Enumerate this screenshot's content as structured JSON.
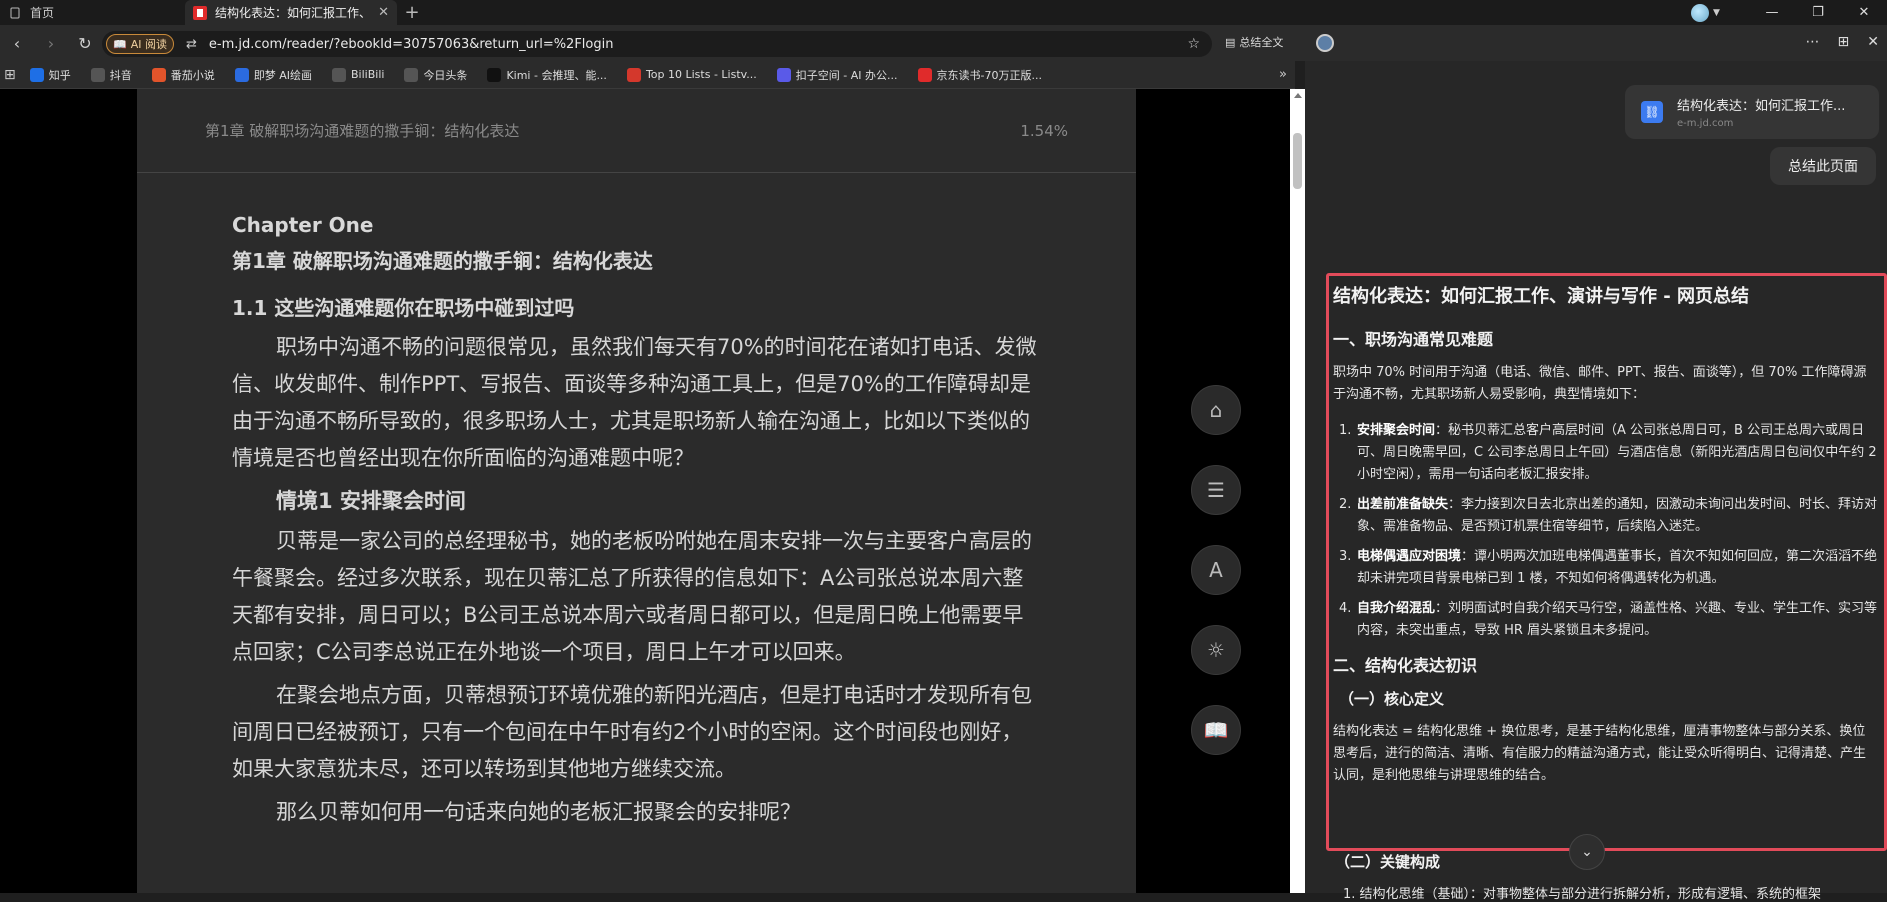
{
  "tabs": {
    "home": "首页",
    "active": "结构化表达：如何汇报工作、演讲与写作"
  },
  "addressbar": {
    "ai_chip": "AI 阅读",
    "url": "e-m.jd.com/reader/?ebookId=30757063&return_url=%2Flogin",
    "summarize_all": "总结全文"
  },
  "bookmarks": [
    {
      "label": "知乎",
      "icon": "zhihu-icon",
      "color": "#1e6fe6"
    },
    {
      "label": "抖音",
      "icon": "globe-icon",
      "color": "#555555"
    },
    {
      "label": "番茄小说",
      "icon": "tomato-icon",
      "color": "#e2542b"
    },
    {
      "label": "即梦 AI绘画",
      "icon": "jimeng-icon",
      "color": "#2b6be0"
    },
    {
      "label": "BiliBili",
      "icon": "globe-icon",
      "color": "#555555"
    },
    {
      "label": "今日头条",
      "icon": "globe-icon",
      "color": "#555555"
    },
    {
      "label": "Kimi - 会推理、能...",
      "icon": "kimi-icon",
      "color": "#111111"
    },
    {
      "label": "Top 10 Lists - Listv...",
      "icon": "listverse-icon",
      "color": "#d4382c"
    },
    {
      "label": "扣子空间 - AI 办公...",
      "icon": "coze-icon",
      "color": "#5a5ae8"
    },
    {
      "label": "京东读书-70万正版...",
      "icon": "jd-icon",
      "color": "#e02b2b"
    }
  ],
  "reader": {
    "header_title": "第1章 破解职场沟通难题的撒手锏：结构化表达",
    "progress": "1.54%",
    "chapter_en": "Chapter One",
    "chapter_cn": "第1章 破解职场沟通难题的撒手锏：结构化表达",
    "section": "1.1 这些沟通难题你在职场中碰到过吗",
    "para1": "职场中沟通不畅的问题很常见，虽然我们每天有70%的时间花在诸如打电话、发微信、收发邮件、制作PPT、写报告、面谈等多种沟通工具上，但是70%的工作障碍却是由于沟通不畅所导致的，很多职场人士，尤其是职场新人输在沟通上，比如以下类似的情境是否也曾经出现在你所面临的沟通难题中呢？",
    "subsec1": "情境1 安排聚会时间",
    "para2": "贝蒂是一家公司的总经理秘书，她的老板吩咐她在周末安排一次与主要客户高层的午餐聚会。经过多次联系，现在贝蒂汇总了所获得的信息如下：A公司张总说本周六整天都有安排，周日可以；B公司王总说本周六或者周日都可以，但是周日晚上他需要早点回家；C公司李总说正在外地谈一个项目，周日上午才可以回来。",
    "para3": "在聚会地点方面，贝蒂想预订环境优雅的新阳光酒店，但是打电话时才发现所有包间周日已经被预订，只有一个包间在中午时有约2个小时的空闲。这个时间段也刚好，如果大家意犹未尽，还可以转场到其他地方继续交流。",
    "para4": "那么贝蒂如何用一句话来向她的老板汇报聚会的安排呢？"
  },
  "panel": {
    "chip_title": "结构化表达：如何汇报工作...",
    "chip_domain": "e-m.jd.com",
    "ask": "总结此页面",
    "summary": {
      "title": "结构化表达：如何汇报工作、演讲与写作 - 网页总结",
      "h2_1": "一、职场沟通常见难题",
      "intro": "职场中 70% 时间用于沟通（电话、微信、邮件、PPT、报告、面谈等），但 70% 工作障碍源于沟通不畅，尤其职场新人易受影响，典型情境如下：",
      "items": [
        {
          "num": "1.",
          "bold": "安排聚会时间",
          "text": "：秘书贝蒂汇总客户高层时间（A 公司张总周日可，B 公司王总周六或周日可、周日晚需早回，C 公司李总周日上午回）与酒店信息（新阳光酒店周日包间仅中午约 2 小时空闲），需用一句话向老板汇报安排。"
        },
        {
          "num": "2.",
          "bold": "出差前准备缺失",
          "text": "：李力接到次日去北京出差的通知，因激动未询问出发时间、时长、拜访对象、需准备物品、是否预订机票住宿等细节，后续陷入迷茫。"
        },
        {
          "num": "3.",
          "bold": "电梯偶遇应对困境",
          "text": "：谭小明两次加班电梯偶遇董事长，首次不知如何回应，第二次滔滔不绝却未讲完项目背景电梯已到 1 楼，不知如何将偶遇转化为机遇。"
        },
        {
          "num": "4.",
          "bold": "自我介绍混乱",
          "text": "：刘明面试时自我介绍天马行空，涵盖性格、兴趣、专业、学生工作、实习等内容，未突出重点，导致 HR 眉头紧锁且未多提问。"
        }
      ],
      "h2_2": "二、结构化表达初识",
      "h3_1": "（一）核心定义",
      "def": "结构化表达 = 结构化思维 + 换位思考，是基于结构化思维，厘清事物整体与部分关系、换位思考后，进行的简洁、清晰、有信服力的精益沟通方式，能让受众听得明白、记得清楚、产生认同，是利他思维与讲理思维的结合。"
    },
    "h3_2": "（二）关键构成",
    "cut_line": "1. 结构化思维（基础）：对事物整体与部分进行拆解分析，形成有逻辑、系统的框架"
  }
}
